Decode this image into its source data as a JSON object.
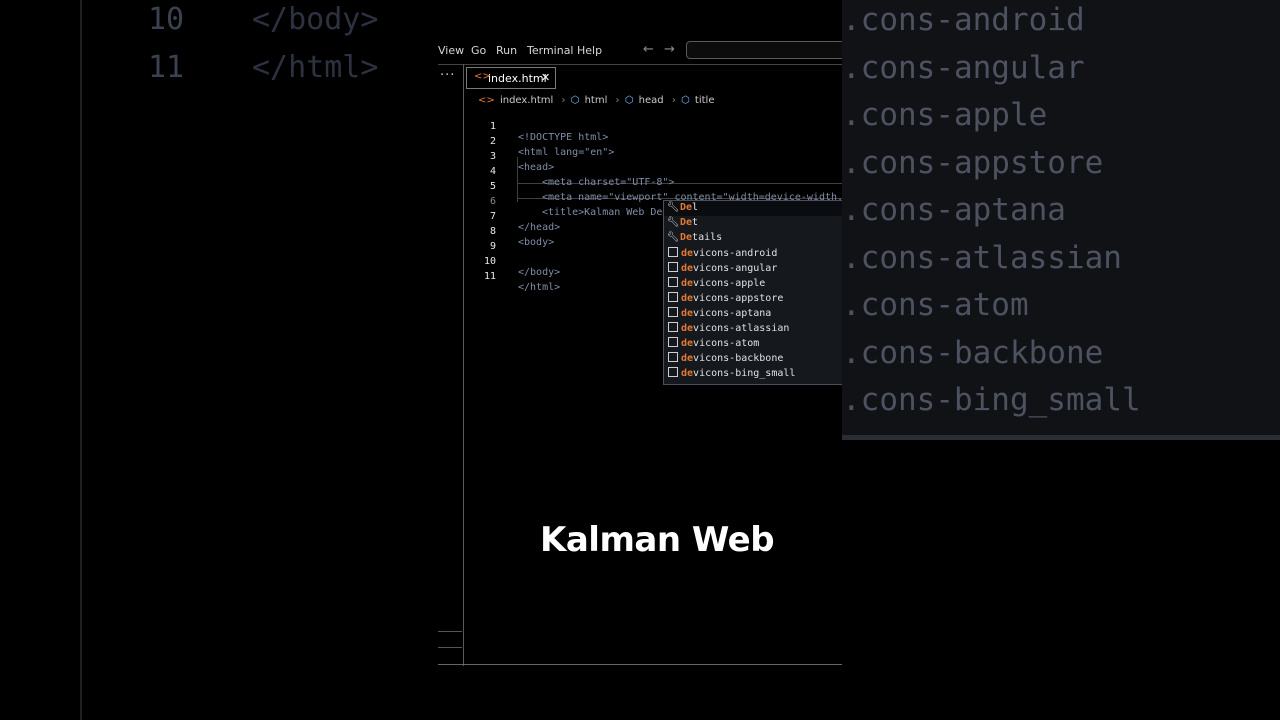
{
  "background_left": {
    "lines": [
      {
        "num": "10",
        "code": "</body>"
      },
      {
        "num": "11",
        "code": "</html>"
      }
    ]
  },
  "background_right": {
    "items": [
      ".cons-android",
      ".cons-angular",
      ".cons-apple",
      ".cons-appstore",
      ".cons-aptana",
      ".cons-atlassian",
      ".cons-atom",
      ".cons-backbone",
      ".cons-bing_small"
    ]
  },
  "menubar": {
    "items": [
      "View",
      "Go",
      "Run",
      "Terminal",
      "Help"
    ],
    "back_arrow": "←",
    "forward_arrow": "→"
  },
  "activity_bar": {
    "more": "···"
  },
  "tab": {
    "icon": "<>",
    "label": "index.html",
    "close": "✕"
  },
  "breadcrumb": {
    "file": "index.html",
    "items": [
      "html",
      "head",
      "title"
    ],
    "sep": "›"
  },
  "editor": {
    "lines": [
      {
        "num": "1",
        "code": "<!DOCTYPE html>"
      },
      {
        "num": "2",
        "code": "<html lang=\"en\">"
      },
      {
        "num": "3",
        "code": "<head>"
      },
      {
        "num": "4",
        "code": "<meta charset=\"UTF-8\">"
      },
      {
        "num": "5",
        "code": "<meta name=\"viewport\" content=\"width=device-width,"
      },
      {
        "num": "6",
        "code": "<title>Kalman Web De</title>"
      },
      {
        "num": "7",
        "code": "</head>"
      },
      {
        "num": "8",
        "code": "<body>"
      },
      {
        "num": "9",
        "code": ""
      },
      {
        "num": "10",
        "code": "</body>"
      },
      {
        "num": "11",
        "code": "</html>"
      }
    ],
    "current_line": 6
  },
  "suggestions": {
    "prefix": "De",
    "items": [
      {
        "kind": "snippet",
        "label": "Del"
      },
      {
        "kind": "snippet",
        "label": "Det"
      },
      {
        "kind": "snippet",
        "label": "Details"
      },
      {
        "kind": "text",
        "label": "devicons-android"
      },
      {
        "kind": "text",
        "label": "devicons-angular"
      },
      {
        "kind": "text",
        "label": "devicons-apple"
      },
      {
        "kind": "text",
        "label": "devicons-appstore"
      },
      {
        "kind": "text",
        "label": "devicons-aptana"
      },
      {
        "kind": "text",
        "label": "devicons-atlassian"
      },
      {
        "kind": "text",
        "label": "devicons-atom"
      },
      {
        "kind": "text",
        "label": "devicons-backbone"
      },
      {
        "kind": "text",
        "label": "devicons-bing_small"
      }
    ]
  },
  "caption": "Kalman Web",
  "colors": {
    "tag": "#7f8ea6",
    "attr": "#9cdcfe",
    "string": "#ce9178",
    "accent": "#e37933"
  }
}
